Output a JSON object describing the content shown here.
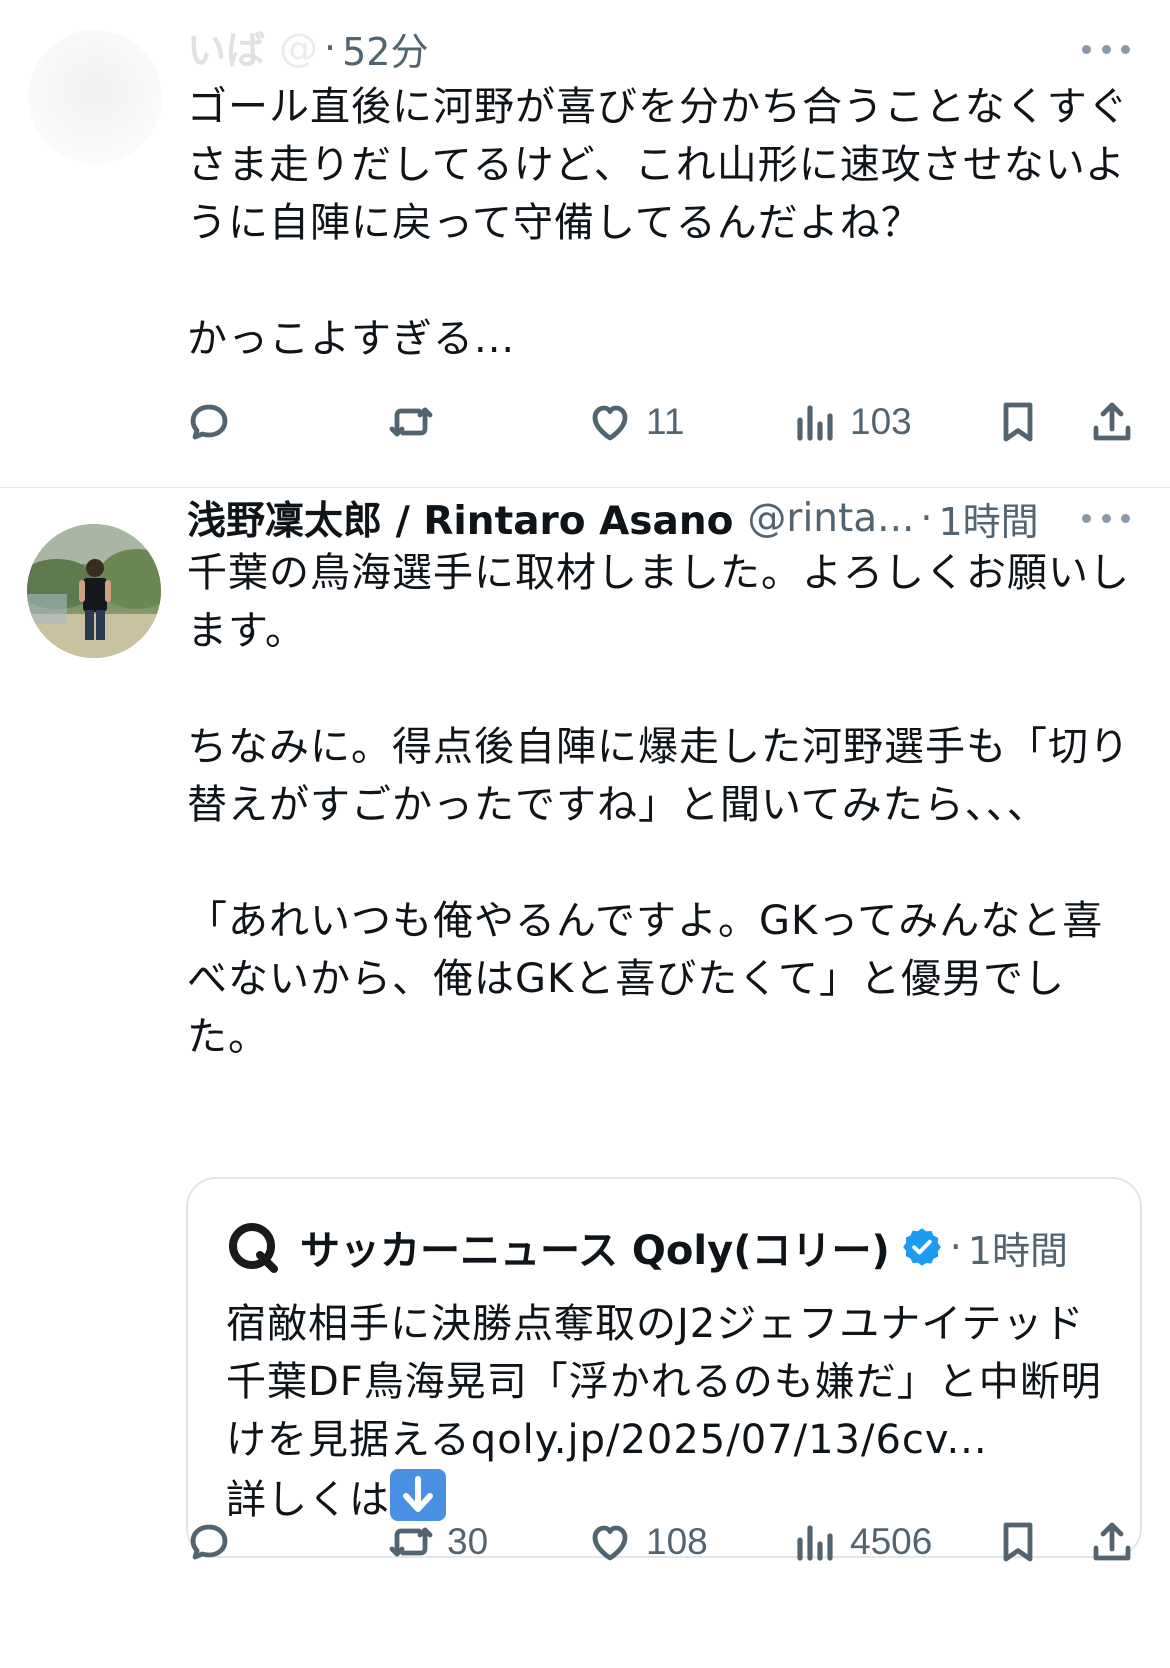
{
  "tweet1": {
    "name": "いば",
    "handle": "@",
    "time_separator": "·",
    "time": "52分",
    "text": "ゴール直後に河野が喜びを分かち合うことなくすぐさま走りだしてるけど、これ山形に速攻させないように自陣に戻って守備してるんだよね？\n\nかっこよすぎる...",
    "actions": {
      "reply_icon": "reply-icon",
      "retweet_icon": "retweet-icon",
      "like_count": "11",
      "views_count": "103"
    }
  },
  "tweet2": {
    "name": "浅野凜太郎 / Rintaro Asano",
    "handle": "@rinta...",
    "time_separator": "·",
    "time": "1時間",
    "text": "千葉の鳥海選手に取材しました。よろしくお願いします。\n\nちなみに。得点後自陣に爆走した河野選手も「切り替えがすごかったですね」と聞いてみたら、、、\n\n「あれいつも俺やるんですよ。GKってみんなと喜べないから、俺はGKと喜びたくて」と優男でした。",
    "quote": {
      "name": "サッカーニュース Qoly(コリー)",
      "time_separator": "·",
      "time": "1時間",
      "text": "宿敵相手に決勝点奪取のJ2ジェフユナイテッド千葉DF鳥海晃司「浮かれるのも嫌だ」と中断明けを見据えるqoly.jp/2025/07/13/6cv...\n詳しくは"
    },
    "actions": {
      "retweet_count": "30",
      "like_count": "108",
      "views_count": "4506"
    }
  },
  "colors": {
    "text_primary": "#0f1419",
    "text_secondary": "#536471",
    "divider": "#e3e6e8",
    "verified": "#1d9bf0"
  }
}
